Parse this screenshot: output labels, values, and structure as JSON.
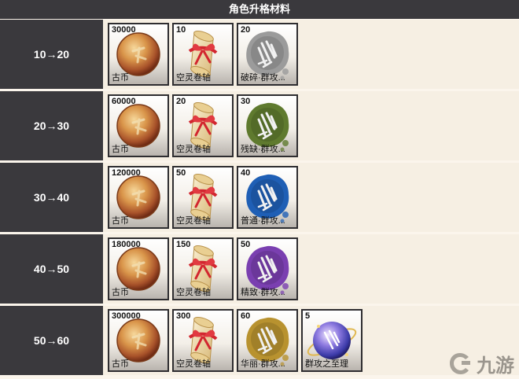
{
  "header": {
    "title": "角色升格材料"
  },
  "rows": [
    {
      "level": "10→20",
      "items": [
        {
          "qty": "30000",
          "name": "古币",
          "icon": "coin-icon"
        },
        {
          "qty": "10",
          "name": "空灵卷轴",
          "icon": "scroll-icon"
        },
        {
          "qty": "20",
          "name": "破碎·群攻...",
          "icon": "gray-seal-icon",
          "color": "#9b9b9b"
        }
      ]
    },
    {
      "level": "20→30",
      "items": [
        {
          "qty": "60000",
          "name": "古币",
          "icon": "coin-icon"
        },
        {
          "qty": "20",
          "name": "空灵卷轴",
          "icon": "scroll-icon"
        },
        {
          "qty": "30",
          "name": "残缺·群攻...",
          "icon": "green-seal-icon",
          "color": "#5f7a2e"
        }
      ]
    },
    {
      "level": "30→40",
      "items": [
        {
          "qty": "120000",
          "name": "古币",
          "icon": "coin-icon"
        },
        {
          "qty": "50",
          "name": "空灵卷轴",
          "icon": "scroll-icon"
        },
        {
          "qty": "40",
          "name": "普通·群攻...",
          "icon": "blue-seal-icon",
          "color": "#1f5fb5"
        }
      ]
    },
    {
      "level": "40→50",
      "items": [
        {
          "qty": "180000",
          "name": "古币",
          "icon": "coin-icon"
        },
        {
          "qty": "150",
          "name": "空灵卷轴",
          "icon": "scroll-icon"
        },
        {
          "qty": "50",
          "name": "精致·群攻...",
          "icon": "purple-seal-icon",
          "color": "#7a3fb0"
        }
      ]
    },
    {
      "level": "50→60",
      "items": [
        {
          "qty": "300000",
          "name": "古币",
          "icon": "coin-icon"
        },
        {
          "qty": "300",
          "name": "空灵卷轴",
          "icon": "scroll-icon"
        },
        {
          "qty": "60",
          "name": "华丽·群攻...",
          "icon": "gold-seal-icon",
          "color": "#b8922f"
        },
        {
          "qty": "5",
          "name": "群攻之至理",
          "icon": "orb-icon"
        }
      ]
    }
  ],
  "watermark": {
    "text": "九游",
    "icon": "jiuyou-logo-icon"
  }
}
